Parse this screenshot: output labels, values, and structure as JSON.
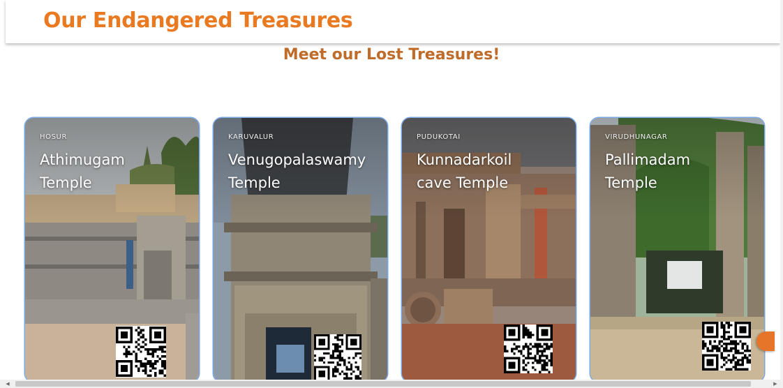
{
  "header": {
    "title": "Our Endangered Treasures"
  },
  "section": {
    "subtitle": "Meet our Lost Treasures!"
  },
  "cards": [
    {
      "location": "HOSUR",
      "name": "Athimugam Temple"
    },
    {
      "location": "KARUVALUR",
      "name": "Venugopalaswamy Temple"
    },
    {
      "location": "PUDUKOTAI",
      "name": "Kunnadarkoil cave Temple"
    },
    {
      "location": "VIRUDHUNAGAR",
      "name": "Pallimadam Temple"
    }
  ],
  "icons": {
    "qr": "qr-code-icon",
    "next": "chevron-right-icon",
    "scroll_left": "caret-left-icon",
    "scroll_right": "caret-right-icon"
  },
  "colors": {
    "title": "#e97a22",
    "subtitle": "#bf6b2a",
    "accent": "#e6752a",
    "card_outline": "#76a7e8"
  }
}
